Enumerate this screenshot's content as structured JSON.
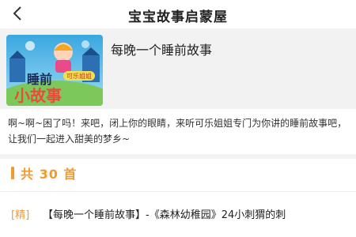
{
  "header": {
    "title": "宝宝故事启蒙屋",
    "back_icon": "chevron-left-icon"
  },
  "book": {
    "title": "每晚一个睡前故事",
    "cover_text_top": "睡前",
    "cover_text_bottom": "小故事",
    "cover_badge": "可乐姐姐",
    "description": "啊~啊~困了吗！来吧，闭上你的眼睛，来听可乐姐姐专门为你讲的睡前故事吧，让我们一起进入甜美的梦乡~"
  },
  "list": {
    "count_label": "共 30 首",
    "items": [
      {
        "tag": "[精]",
        "title": "【每晚一个睡前故事】-《森林幼稚园》24小刺猬的刺"
      }
    ]
  },
  "colors": {
    "accent": "#f29a2e",
    "background_gray": "#f2f2f2"
  }
}
